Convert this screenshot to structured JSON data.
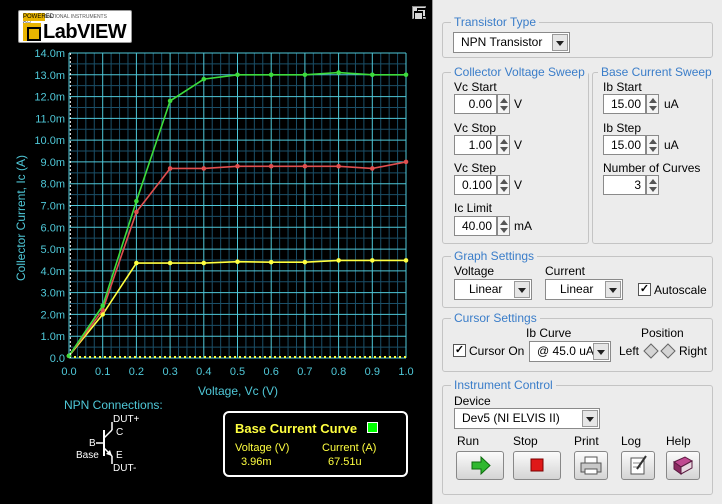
{
  "logo": {
    "brand_small": "POWERED BY",
    "brand_sub": "NATIONAL INSTRUMENTS",
    "text": "LabVIEW"
  },
  "chart_data": {
    "type": "line",
    "xlabel": "Voltage, Vc (V)",
    "ylabel": "Collector Current, Ic (A)",
    "xlim": [
      0,
      1.0
    ],
    "ylim": [
      0,
      0.014
    ],
    "x_ticks": [
      "0.0",
      "0.1",
      "0.2",
      "0.3",
      "0.4",
      "0.5",
      "0.6",
      "0.7",
      "0.8",
      "0.9",
      "1.0"
    ],
    "y_ticks": [
      "0.0",
      "1.0m",
      "2.0m",
      "3.0m",
      "4.0m",
      "5.0m",
      "6.0m",
      "7.0m",
      "8.0m",
      "9.0m",
      "10.0m",
      "11.0m",
      "12.0m",
      "13.0m",
      "14.0m"
    ],
    "grid": true,
    "x": [
      0.0,
      0.1,
      0.2,
      0.3,
      0.4,
      0.5,
      0.6,
      0.7,
      0.8,
      0.9,
      1.0
    ],
    "series": [
      {
        "color": "#ffff40",
        "values": [
          0.0001,
          0.002,
          0.00436,
          0.00436,
          0.00436,
          0.00442,
          0.0044,
          0.0044,
          0.00448,
          0.00448,
          0.00448
        ]
      },
      {
        "color": "#e05050",
        "values": [
          0.0001,
          0.0022,
          0.0067,
          0.0087,
          0.0087,
          0.0088,
          0.0088,
          0.0088,
          0.0088,
          0.0087,
          0.009
        ]
      },
      {
        "color": "#3ddc3d",
        "values": [
          0.0001,
          0.0024,
          0.0072,
          0.0118,
          0.0128,
          0.013,
          0.013,
          0.013,
          0.0131,
          0.013,
          0.013
        ]
      }
    ],
    "cursor": {
      "voltage": 0.00396,
      "color": "#ffffff"
    },
    "bottom_line_color": "#ffff40"
  },
  "npn": {
    "title": "NPN Connections:",
    "dut_plus": "DUT+",
    "dut_minus": "DUT-",
    "b": "B",
    "c": "C",
    "e": "E",
    "base": "Base"
  },
  "bcc": {
    "title": "Base Current Curve",
    "voltage_label": "Voltage (V)",
    "current_label": "Current (A)",
    "voltage_value": "3.96m",
    "current_value": "67.51u"
  },
  "transistor": {
    "group_title": "Transistor Type",
    "value": "NPN Transistor"
  },
  "vsweep": {
    "group_title": "Collector Voltage Sweep",
    "vc_start_label": "Vc Start",
    "vc_start": "0.00",
    "vc_start_unit": "V",
    "vc_stop_label": "Vc Stop",
    "vc_stop": "1.00",
    "vc_stop_unit": "V",
    "vc_step_label": "Vc Step",
    "vc_step": "0.100",
    "vc_step_unit": "V",
    "ic_limit_label": "Ic Limit",
    "ic_limit": "40.00",
    "ic_limit_unit": "mA"
  },
  "isweep": {
    "group_title": "Base Current Sweep",
    "ib_start_label": "Ib Start",
    "ib_start": "15.00",
    "ib_start_unit": "uA",
    "ib_step_label": "Ib Step",
    "ib_step": "15.00",
    "ib_step_unit": "uA",
    "curves_label": "Number of Curves",
    "curves": "3"
  },
  "graph": {
    "group_title": "Graph Settings",
    "voltage_label": "Voltage",
    "voltage_value": "Linear",
    "current_label": "Current",
    "current_value": "Linear",
    "autoscale_label": "Autoscale",
    "autoscale_mark": "✓"
  },
  "cursor": {
    "group_title": "Cursor Settings",
    "ib_curve_label": "Ib Curve",
    "position_label": "Position",
    "cursor_on_label": "Cursor On",
    "cursor_on_mark": "✓",
    "ib_curve_value": "@ 45.0 uA",
    "left_label": "Left",
    "right_label": "Right"
  },
  "instrument": {
    "group_title": "Instrument Control",
    "device_label": "Device",
    "device_value": "Dev5 (NI ELVIS II)",
    "run_label": "Run",
    "stop_label": "Stop",
    "print_label": "Print",
    "log_label": "Log",
    "help_label": "Help"
  }
}
